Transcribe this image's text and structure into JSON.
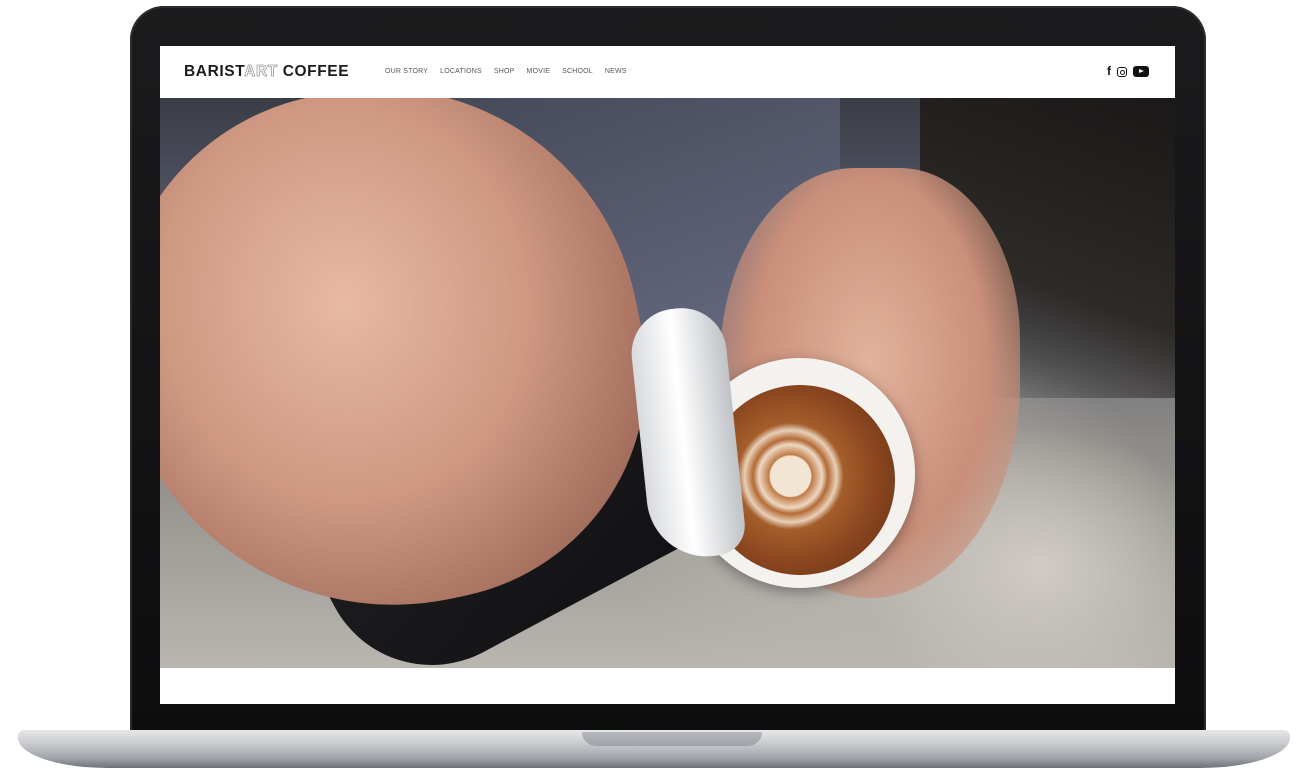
{
  "site": {
    "logo_part1": "BARIST",
    "logo_part2": "ART",
    "logo_part3": " COFFEE"
  },
  "nav": {
    "items": [
      "OUR STORY",
      "LOCATIONS",
      "SHOP",
      "MOVIE",
      "SCHOOL",
      "NEWS"
    ]
  },
  "social": {
    "facebook_glyph": "f",
    "icons": [
      "facebook-icon",
      "instagram-icon",
      "youtube-icon"
    ]
  },
  "hero": {
    "image_description_icon": "latte-art-photo",
    "slide_count": 8,
    "active_slide": 7
  },
  "colors": {
    "accent": "#e53935",
    "text": "#1b1b1b",
    "bezel": "#111111"
  }
}
